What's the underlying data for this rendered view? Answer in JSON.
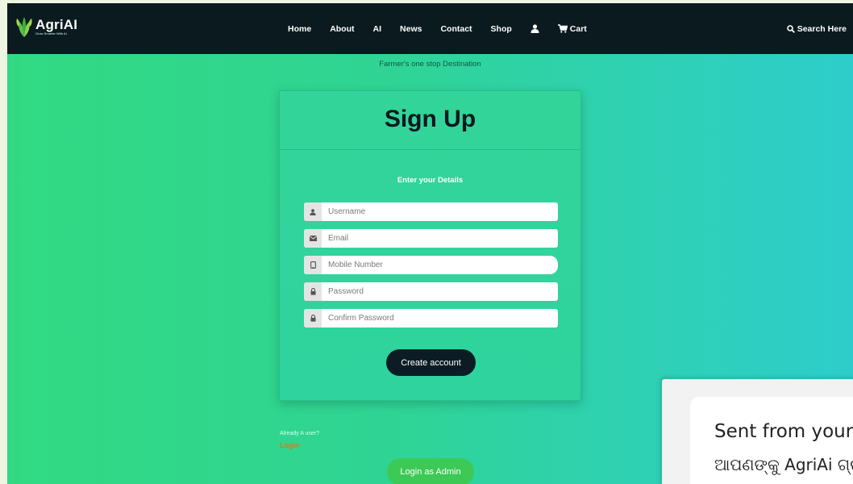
{
  "brand": {
    "name": "AgriAI",
    "tagline_small": "Grow Smarter With AI",
    "accent_color": "#3cc956"
  },
  "nav": {
    "items": [
      "Home",
      "About",
      "AI",
      "News",
      "Contact",
      "Shop"
    ],
    "user_icon": "user-icon",
    "cart_label": "Cart",
    "search_label": "Search Here"
  },
  "page": {
    "tagline": "Farmer's one stop Destination"
  },
  "signup": {
    "title": "Sign Up",
    "subtitle": "Enter your Details",
    "fields": [
      {
        "placeholder": "Username",
        "icon": "user-icon"
      },
      {
        "placeholder": "Email",
        "icon": "envelope-icon"
      },
      {
        "placeholder": "Mobile Number",
        "icon": "mobile-icon"
      },
      {
        "placeholder": "Password",
        "icon": "lock-icon"
      },
      {
        "placeholder": "Confirm Password",
        "icon": "lock-icon"
      }
    ],
    "submit_label": "Create account"
  },
  "footer_links": {
    "already_user": "Already A user?",
    "login_label": "Login",
    "admin_login_label": "Login as Admin"
  },
  "notification": {
    "line1": "Sent from your",
    "line2": "ଆପଣଙ୍କୁ AgriAi ଗ୍ର"
  }
}
